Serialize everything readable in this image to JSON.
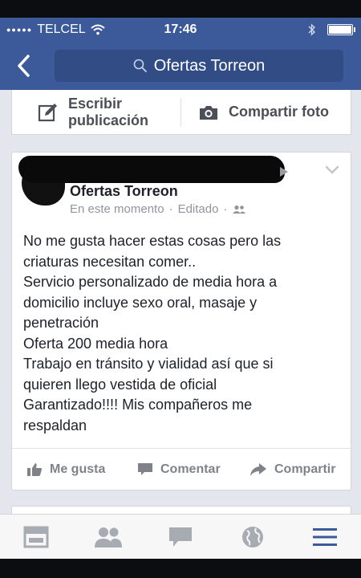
{
  "status_bar": {
    "carrier": "TELCEL",
    "time": "17:46"
  },
  "nav": {
    "search_text": "Ofertas Torreon"
  },
  "composer": {
    "write_label_line1": "Escribir",
    "write_label_line2": "publicación",
    "photo_label": "Compartir foto"
  },
  "post": {
    "author_name": "Ofertas Torreon",
    "timestamp": "En este momento",
    "separator": "·",
    "edited": "Editado",
    "body_lines": [
      "No me gusta hacer estas cosas pero las",
      "criaturas necesitan comer..",
      "Servicio personalizado de media hora a",
      "domicilio incluye sexo oral, masaje y",
      "penetración",
      "Oferta 200 media hora",
      "Trabajo en tránsito y vialidad así que si",
      "quieren llego vestida de oficial",
      "Garantizado!!!! Mis compañeros me",
      "respaldan"
    ],
    "actions": {
      "like": "Me gusta",
      "comment": "Comentar",
      "share": "Compartir"
    }
  },
  "tabbar": {
    "icons": [
      "news-feed-icon",
      "friends-icon",
      "messages-icon",
      "globe-icon",
      "menu-icon"
    ]
  },
  "colors": {
    "brand_blue": "#3c5a99",
    "search_field": "#324d86",
    "background": "#e3e6ec",
    "muted_text": "#90949c",
    "tab_active": "#3c5a99",
    "tab_inactive": "#a7abb2"
  }
}
